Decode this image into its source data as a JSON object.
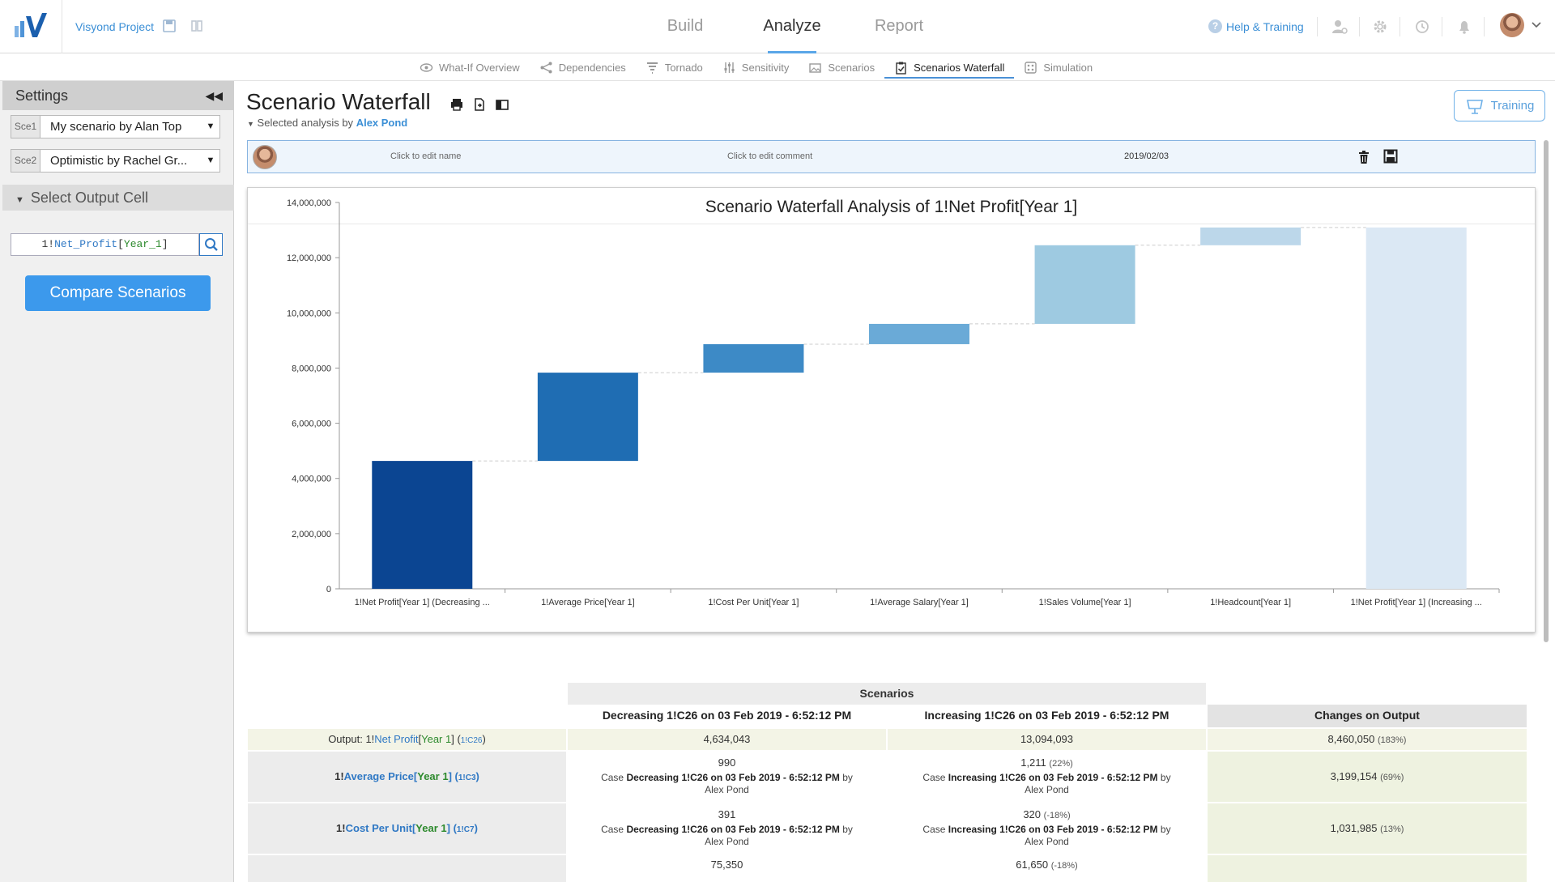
{
  "header": {
    "project_name": "Visyond Project",
    "nav": [
      "Build",
      "Analyze",
      "Report"
    ],
    "active_nav": "Analyze",
    "help_label": "Help & Training"
  },
  "subnav": {
    "items": [
      "What-If Overview",
      "Dependencies",
      "Tornado",
      "Sensitivity",
      "Scenarios",
      "Scenarios Waterfall",
      "Simulation"
    ],
    "active": "Scenarios Waterfall"
  },
  "settings": {
    "title": "Settings",
    "sce1_tag": "Sce1",
    "sce1_value": "My scenario by Alan Top",
    "sce2_tag": "Sce2",
    "sce2_value": "Optimistic by Rachel Gr...",
    "select_output_label": "Select Output Cell",
    "output_cell": {
      "sheet": "1!",
      "name": "Net_Profit",
      "index": "Year_1"
    },
    "compare_button": "Compare Scenarios"
  },
  "page": {
    "title": "Scenario Waterfall",
    "subtitle_prefix": "Selected analysis by",
    "subtitle_author": "Alex Pond",
    "training_label": "Training"
  },
  "edit_row": {
    "name_placeholder": "Click to edit name",
    "comment_placeholder": "Click to edit comment",
    "date": "2019/02/03"
  },
  "chart_data": {
    "type": "bar",
    "subtype": "waterfall",
    "title": "Scenario Waterfall Analysis of 1!Net Profit[Year 1]",
    "categories": [
      "1!Net Profit[Year 1] (Decreasing ...",
      "1!Average Price[Year 1]",
      "1!Cost Per Unit[Year 1]",
      "1!Average Salary[Year 1]",
      "1!Sales Volume[Year 1]",
      "1!Headcount[Year 1]",
      "1!Net Profit[Year 1] (Increasing ..."
    ],
    "bars": [
      {
        "start": 0,
        "end": 4634043,
        "color": "#0b4592"
      },
      {
        "start": 4634043,
        "end": 7833197,
        "color": "#1f6db3"
      },
      {
        "start": 7833197,
        "end": 8865182,
        "color": "#3d8ac6"
      },
      {
        "start": 8865182,
        "end": 9600000,
        "color": "#6aaad7"
      },
      {
        "start": 9600000,
        "end": 12450000,
        "color": "#9ecae1"
      },
      {
        "start": 12450000,
        "end": 13094093,
        "color": "#bcd7ea"
      },
      {
        "start": 0,
        "end": 13094093,
        "color": "#dbe8f4"
      }
    ],
    "yticks": [
      "0",
      "2,000,000",
      "4,000,000",
      "6,000,000",
      "8,000,000",
      "10,000,000",
      "12,000,000",
      "14,000,000"
    ],
    "ylim": [
      0,
      14000000
    ],
    "grid": false
  },
  "results": {
    "scenarios_header": "Scenarios",
    "col_decreasing": "Decreasing 1!C26 on 03 Feb 2019 - 6:52:12 PM",
    "col_increasing": "Increasing 1!C26 on 03 Feb 2019 - 6:52:12 PM",
    "col_changes": "Changes on Output",
    "output_row": {
      "label_prefix": "Output:",
      "sheet": "1!",
      "name": "Net Profit",
      "index": "Year 1",
      "ref": "1!C26",
      "decreasing": "4,634,043",
      "increasing": "13,094,093",
      "change": "8,460,050",
      "change_pct": "(183%)"
    },
    "rows": [
      {
        "sheet": "1!",
        "name": "Average Price",
        "index": "Year 1",
        "ref": "1!C3",
        "dec_value": "990",
        "inc_value": "1,211",
        "inc_pct": "(22%)",
        "dec_case_pre": "Case",
        "dec_case_bold": "Decreasing 1!C26 on 03 Feb 2019 - 6:52:12 PM",
        "dec_case_post": "by",
        "inc_case_pre": "Case",
        "inc_case_bold": "Increasing 1!C26 on 03 Feb 2019 - 6:52:12 PM",
        "inc_case_post": "by",
        "author": "Alex Pond",
        "change": "3,199,154",
        "change_pct": "(69%)"
      },
      {
        "sheet": "1!",
        "name": "Cost Per Unit",
        "index": "Year 1",
        "ref": "1!C7",
        "dec_value": "391",
        "inc_value": "320",
        "inc_pct": "(-18%)",
        "dec_case_pre": "Case",
        "dec_case_bold": "Decreasing 1!C26 on 03 Feb 2019 - 6:52:12 PM",
        "dec_case_post": "by",
        "inc_case_pre": "Case",
        "inc_case_bold": "Increasing 1!C26 on 03 Feb 2019 - 6:52:12 PM",
        "inc_case_post": "by",
        "author": "Alex Pond",
        "change": "1,031,985",
        "change_pct": "(13%)"
      }
    ],
    "partial_row": {
      "dec_value": "75,350",
      "inc_value": "61,650",
      "inc_pct": "(-18%)"
    }
  }
}
